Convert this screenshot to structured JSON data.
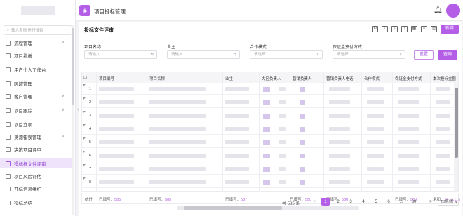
{
  "sidebar": {
    "search_placeholder": "输入名称 进行搜索",
    "items": [
      {
        "label": "流程管理",
        "chev": "∨"
      },
      {
        "label": "项目看板",
        "chev": ""
      },
      {
        "label": "用户个人工作台",
        "chev": ""
      },
      {
        "label": "区域管理",
        "chev": ""
      },
      {
        "label": "客户管理",
        "chev": "∨"
      },
      {
        "label": "项目跟踪",
        "chev": "∨"
      },
      {
        "label": "项目立项",
        "chev": ""
      },
      {
        "label": "资源错误管理",
        "chev": "∨"
      },
      {
        "label": "决策项目评审",
        "chev": ""
      },
      {
        "label": "投标标文件评审",
        "chev": ""
      },
      {
        "label": "项目风险评估",
        "chev": ""
      },
      {
        "label": "开标信息维护",
        "chev": ""
      },
      {
        "label": "投标总结",
        "chev": ""
      }
    ]
  },
  "header": {
    "title": "项目投标管理",
    "icon": "tag-icon"
  },
  "panel": {
    "title": "投标文件评审",
    "add_label": "新增",
    "filters": [
      {
        "label": "项目名称",
        "placeholder": "请输入",
        "suffix": "⇆"
      },
      {
        "label": "业主",
        "placeholder": "请输入",
        "suffix": "⇆"
      },
      {
        "label": "合作模式",
        "placeholder": "请选择",
        "suffix": "∨"
      },
      {
        "label": "保证金支付方式",
        "placeholder": "请选择",
        "suffix": "∨"
      }
    ],
    "reset_label": "重置",
    "search_label": "查询"
  },
  "table": {
    "columns": [
      "项目编号",
      "项目名称",
      "业主",
      "大区负责人",
      "营销负责人",
      "营销负责人电话",
      "合作模式",
      "保证金支付方式",
      "本次投标金额"
    ],
    "rows": [
      "1",
      "2",
      "3",
      "4",
      "5",
      "6",
      "7",
      "8"
    ]
  },
  "footer": {
    "label": "统计",
    "stats": [
      {
        "prefix": "已填写：",
        "value": "585"
      },
      {
        "prefix": "已填写：",
        "value": "585"
      },
      {
        "prefix": "已填写：",
        "value": "537"
      },
      {
        "prefix": "已填写：",
        "value": "580"
      },
      {
        "prefix": "已填写：",
        "value": "580"
      },
      {
        "prefix": "已填写：",
        "value": "580"
      },
      {
        "prefix": "求和：",
        "value": "5473.116"
      }
    ]
  },
  "pagination": {
    "total": "共 585 条",
    "prev": "<",
    "pages": [
      "1",
      "2",
      "3",
      "4",
      "5",
      "6",
      "...",
      "30"
    ],
    "next": ">",
    "active": "1",
    "page_size": "20条/页"
  },
  "colors": {
    "accent": "#b45ee8",
    "accent_light": "#efe2fb"
  }
}
